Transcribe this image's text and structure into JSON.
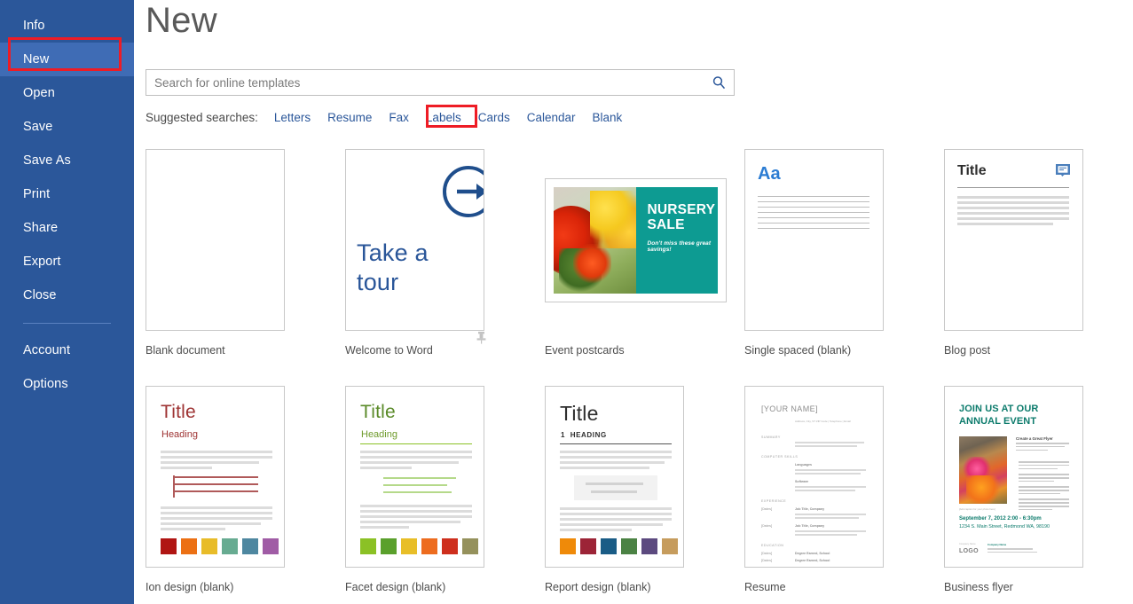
{
  "sidebar": {
    "items": [
      {
        "label": "Info",
        "active": false
      },
      {
        "label": "New",
        "active": true
      },
      {
        "label": "Open",
        "active": false
      },
      {
        "label": "Save",
        "active": false
      },
      {
        "label": "Save As",
        "active": false
      },
      {
        "label": "Print",
        "active": false
      },
      {
        "label": "Share",
        "active": false
      },
      {
        "label": "Export",
        "active": false
      },
      {
        "label": "Close",
        "active": false
      }
    ],
    "bottom_items": [
      {
        "label": "Account"
      },
      {
        "label": "Options"
      }
    ],
    "accent_color": "#2b579a",
    "active_color": "#3f6cb5"
  },
  "annotation": {
    "color": "#ee1c25",
    "targets": [
      "New",
      "Cards"
    ]
  },
  "header": {
    "title": "New"
  },
  "search": {
    "placeholder": "Search for online templates",
    "value": "",
    "icon": "search-icon"
  },
  "suggested": {
    "label": "Suggested searches:",
    "links": [
      "Letters",
      "Resume",
      "Fax",
      "Labels",
      "Cards",
      "Calendar",
      "Blank"
    ],
    "highlighted": "Cards"
  },
  "templates": {
    "row1": [
      {
        "caption": "Blank document",
        "kind": "blank"
      },
      {
        "caption": "Welcome to Word",
        "kind": "tour",
        "text_line1": "Take a",
        "text_line2": "tour",
        "pinned": true,
        "pin_icon": "pin-icon"
      },
      {
        "caption": "Event postcards",
        "kind": "postcard",
        "title": "NURSERY SALE",
        "subtitle": "Don't miss these great savings!",
        "panel_color": "#0d9b92"
      },
      {
        "caption": "Single spaced (blank)",
        "kind": "singlespaced",
        "sample": "Aa",
        "sample_color": "#2b7cd3"
      },
      {
        "caption": "Blog post",
        "kind": "blogpost",
        "title": "Title",
        "icon": "comment-icon"
      }
    ],
    "row2": [
      {
        "caption": "Ion design (blank)",
        "kind": "design",
        "title": "Title",
        "heading": "Heading",
        "title_color": "#9e3333",
        "heading_color": "#9e3333",
        "accent": "#b05a5a",
        "swatches": [
          "#b01513",
          "#ec7014",
          "#e8bc29",
          "#67ab91",
          "#4e87a0",
          "#a05ca5"
        ]
      },
      {
        "caption": "Facet design (blank)",
        "kind": "design",
        "title": "Title",
        "heading": "Heading",
        "title_color": "#5a8a28",
        "heading_color": "#6f9b2c",
        "accent": "#b5d98a",
        "swatches": [
          "#8bc125",
          "#5aa02c",
          "#e8be28",
          "#ed6c1f",
          "#ce2f1d",
          "#95915c"
        ]
      },
      {
        "caption": "Report design (blank)",
        "kind": "report",
        "title": "Title",
        "heading_num": "1",
        "heading": "HEADING",
        "title_color": "#2f2f2f",
        "heading_color": "#2f2f2f",
        "swatches": [
          "#ef8a09",
          "#9c2437",
          "#1a5c86",
          "#4b8244",
          "#5c4a7f",
          "#c69c5d"
        ]
      },
      {
        "caption": "Resume",
        "kind": "resume",
        "name": "[YOUR NAME]",
        "contact": "Address, City, ST  ZIP Code | Telephone | Email",
        "sections": [
          "SUMMARY",
          "COMPUTER SKILLS",
          "EXPERIENCE",
          "EDUCATION"
        ],
        "sub_items": [
          "Languages",
          "Software"
        ],
        "job_labels": [
          "Job Title, Company",
          "Job Title, Company"
        ],
        "edu_labels": [
          "Degree Earned, School",
          "Degree Earned, School"
        ],
        "date_label": "[Dates]"
      },
      {
        "caption": "Business flyer",
        "kind": "flyer",
        "title_line1": "JOIN US AT OUR",
        "title_line2": "ANNUAL EVENT",
        "title_color": "#0c7b6c",
        "body_heading": "Create a Great Flyer",
        "photo_caption": "[Add caption for your photo here]",
        "date": "September 7, 2012  2:00 - 6:30pm",
        "address": "1234 S. Main Street, Redmond WA, 98190",
        "logo": "LOGO",
        "logo_top": "Company Name"
      }
    ]
  }
}
